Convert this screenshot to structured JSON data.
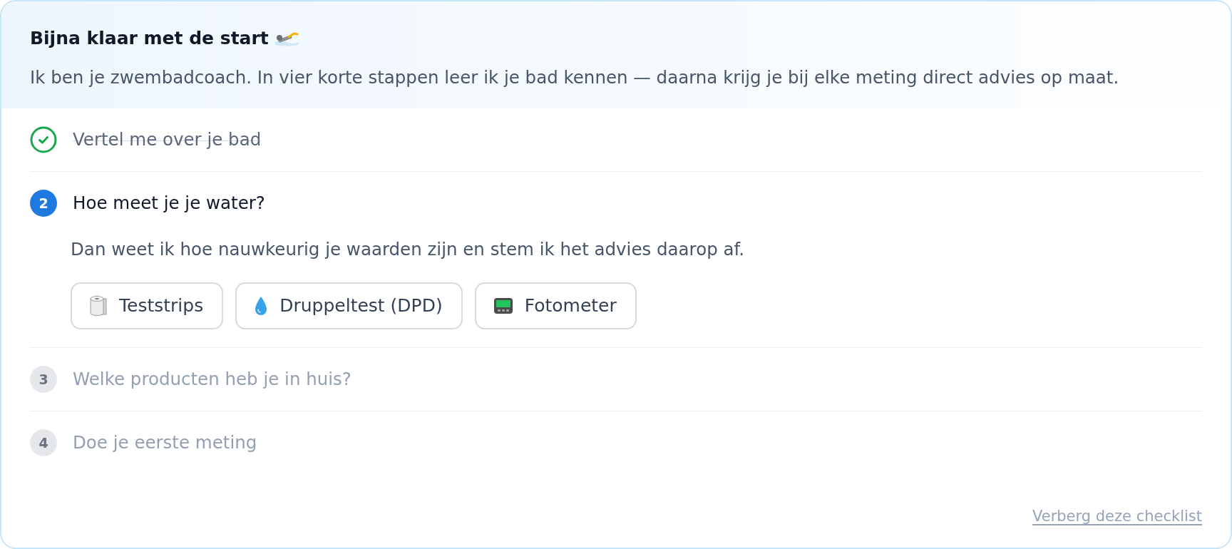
{
  "header": {
    "title": "Bijna klaar met de start",
    "subtitle": "Ik ben je zwembadcoach. In vier korte stappen leer ik je bad kennen — daarna krijg je bij elke meting direct advies op maat."
  },
  "steps": [
    {
      "label": "Vertel me over je bad",
      "done": true,
      "active": false
    },
    {
      "number": "2",
      "label": "Hoe meet je je water?",
      "done": false,
      "active": true,
      "description": "Dan weet ik hoe nauwkeurig je waarden zijn en stem ik het advies daarop af.",
      "options": [
        {
          "label": "Teststrips",
          "selected": false
        },
        {
          "label": "Druppeltest (DPD)",
          "selected": false
        },
        {
          "label": "Fotometer",
          "selected": false
        }
      ]
    },
    {
      "number": "3",
      "label": "Welke producten heb je in huis?",
      "done": false,
      "active": false
    },
    {
      "number": "4",
      "label": "Doe je eerste meting",
      "done": false,
      "active": false
    }
  ],
  "hide_link": "Verberg deze checklist"
}
